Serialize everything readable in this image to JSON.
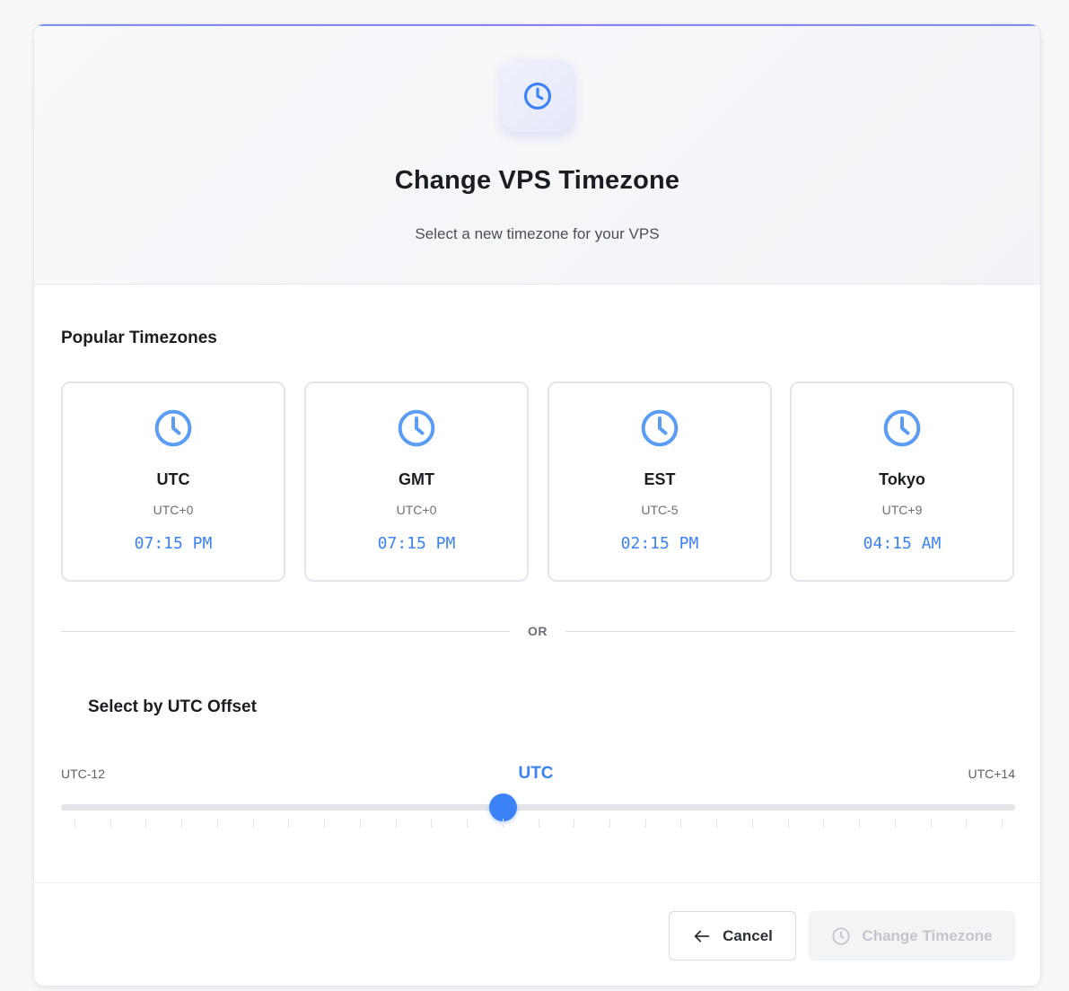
{
  "header": {
    "icon": "clock-icon",
    "title": "Change VPS Timezone",
    "subtitle": "Select a new timezone for your VPS"
  },
  "popular": {
    "heading": "Popular Timezones",
    "items": [
      {
        "name": "UTC",
        "offset": "UTC+0",
        "time": "07:15 PM",
        "icon": "clock-icon"
      },
      {
        "name": "GMT",
        "offset": "UTC+0",
        "time": "07:15 PM",
        "icon": "clock-icon"
      },
      {
        "name": "EST",
        "offset": "UTC-5",
        "time": "02:15 PM",
        "icon": "clock-icon"
      },
      {
        "name": "Tokyo",
        "offset": "UTC+9",
        "time": "04:15 AM",
        "icon": "clock-icon"
      }
    ]
  },
  "divider": {
    "label": "OR"
  },
  "offset_selector": {
    "heading": "Select by UTC Offset",
    "min_label": "UTC-12",
    "max_label": "UTC+14",
    "current_label": "UTC",
    "min": -12,
    "max": 14,
    "value": 0
  },
  "footer": {
    "cancel_label": "Cancel",
    "cancel_icon": "arrow-left-icon",
    "submit_label": "Change Timezone",
    "submit_icon": "clock-icon",
    "submit_disabled": true
  },
  "colors": {
    "accent": "#3b82f6",
    "card_border": "#e4e5e8",
    "disabled_text": "#c3c6cc"
  }
}
